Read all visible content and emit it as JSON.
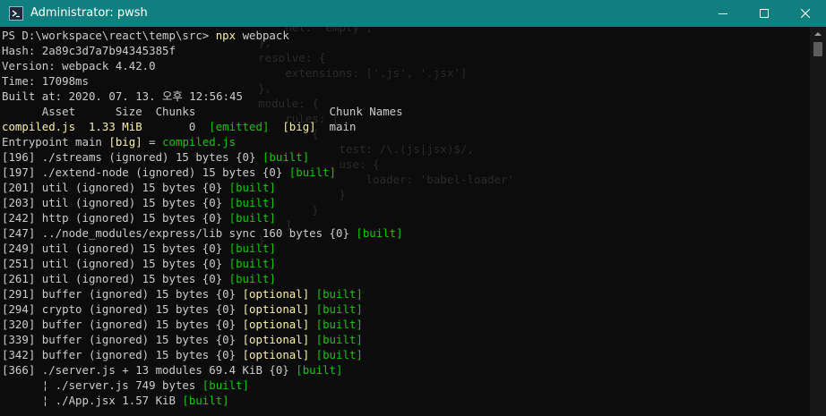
{
  "window": {
    "title": "Administrator: pwsh",
    "colors": {
      "titlebar": "#0f7f7f",
      "background": "#0c0c0c",
      "text": "#cccccc",
      "yellow": "#f9f1a5",
      "green": "#16c60c"
    }
  },
  "ghost_lines": [
    {
      "text": "        net: 'empty',",
      "row": 0
    },
    {
      "text": "    },",
      "row": 1
    },
    {
      "text": "    resolve: {",
      "row": 2
    },
    {
      "text": "        extensions: ['.js', '.jsx']",
      "row": 3
    },
    {
      "text": "    },",
      "row": 4
    },
    {
      "text": "    module: {",
      "row": 5
    },
    {
      "text": "        rules: [",
      "row": 6
    },
    {
      "text": "            {",
      "row": 7
    },
    {
      "text": "                test: /\\.(js|jsx)$/,",
      "row": 8
    },
    {
      "text": "                use: {",
      "row": 9
    },
    {
      "text": "                    loader: 'babel-loader'",
      "row": 10
    },
    {
      "text": "                }",
      "row": 11
    },
    {
      "text": "            }",
      "row": 12
    },
    {
      "text": "        ]",
      "row": 13
    },
    {
      "text": "    }",
      "row": 14
    }
  ],
  "lines": [
    [
      {
        "t": "PS D:\\workspace\\react\\temp\\src> ",
        "c": "default"
      },
      {
        "t": "npx",
        "c": "yellow"
      },
      {
        "t": " webpack",
        "c": "default"
      }
    ],
    [
      {
        "t": "Hash: 2a89c3d7a7b94345385f",
        "c": "default"
      }
    ],
    [
      {
        "t": "Version: webpack 4.42.0",
        "c": "default"
      }
    ],
    [
      {
        "t": "Time: 17098ms",
        "c": "default"
      }
    ],
    [
      {
        "t": "Built at: 2020. 07. 13. 오후 12:56:45",
        "c": "default"
      }
    ],
    [
      {
        "t": "      Asset      Size  Chunks                    Chunk Names",
        "c": "default"
      }
    ],
    [
      {
        "t": "compiled.js  1.33 MiB",
        "c": "yellow"
      },
      {
        "t": "       0  ",
        "c": "default"
      },
      {
        "t": "[emitted]",
        "c": "green"
      },
      {
        "t": "  ",
        "c": "default"
      },
      {
        "t": "[big]",
        "c": "yellow"
      },
      {
        "t": "  main",
        "c": "default"
      }
    ],
    [
      {
        "t": "Entrypoint main ",
        "c": "default"
      },
      {
        "t": "[big]",
        "c": "yellow"
      },
      {
        "t": " = ",
        "c": "default"
      },
      {
        "t": "compiled.js",
        "c": "green"
      }
    ],
    [
      {
        "t": "[196] ./streams (ignored) 15 bytes {0} ",
        "c": "default"
      },
      {
        "t": "[built]",
        "c": "green"
      }
    ],
    [
      {
        "t": "[197] ./extend-node (ignored) 15 bytes {0} ",
        "c": "default"
      },
      {
        "t": "[built]",
        "c": "green"
      }
    ],
    [
      {
        "t": "[201] util (ignored) 15 bytes {0} ",
        "c": "default"
      },
      {
        "t": "[built]",
        "c": "green"
      }
    ],
    [
      {
        "t": "[203] util (ignored) 15 bytes {0} ",
        "c": "default"
      },
      {
        "t": "[built]",
        "c": "green"
      }
    ],
    [
      {
        "t": "[242] http (ignored) 15 bytes {0} ",
        "c": "default"
      },
      {
        "t": "[built]",
        "c": "green"
      }
    ],
    [
      {
        "t": "[247] ../node_modules/express/lib sync 160 bytes {0} ",
        "c": "default"
      },
      {
        "t": "[built]",
        "c": "green"
      }
    ],
    [
      {
        "t": "[249] util (ignored) 15 bytes {0} ",
        "c": "default"
      },
      {
        "t": "[built]",
        "c": "green"
      }
    ],
    [
      {
        "t": "[251] util (ignored) 15 bytes {0} ",
        "c": "default"
      },
      {
        "t": "[built]",
        "c": "green"
      }
    ],
    [
      {
        "t": "[261] util (ignored) 15 bytes {0} ",
        "c": "default"
      },
      {
        "t": "[built]",
        "c": "green"
      }
    ],
    [
      {
        "t": "[291] buffer (ignored) 15 bytes {0} ",
        "c": "default"
      },
      {
        "t": "[optional]",
        "c": "yellow"
      },
      {
        "t": " ",
        "c": "default"
      },
      {
        "t": "[built]",
        "c": "green"
      }
    ],
    [
      {
        "t": "[294] crypto (ignored) 15 bytes {0} ",
        "c": "default"
      },
      {
        "t": "[optional]",
        "c": "yellow"
      },
      {
        "t": " ",
        "c": "default"
      },
      {
        "t": "[built]",
        "c": "green"
      }
    ],
    [
      {
        "t": "[320] buffer (ignored) 15 bytes {0} ",
        "c": "default"
      },
      {
        "t": "[optional]",
        "c": "yellow"
      },
      {
        "t": " ",
        "c": "default"
      },
      {
        "t": "[built]",
        "c": "green"
      }
    ],
    [
      {
        "t": "[339] buffer (ignored) 15 bytes {0} ",
        "c": "default"
      },
      {
        "t": "[optional]",
        "c": "yellow"
      },
      {
        "t": " ",
        "c": "default"
      },
      {
        "t": "[built]",
        "c": "green"
      }
    ],
    [
      {
        "t": "[342] buffer (ignored) 15 bytes {0} ",
        "c": "default"
      },
      {
        "t": "[optional]",
        "c": "yellow"
      },
      {
        "t": " ",
        "c": "default"
      },
      {
        "t": "[built]",
        "c": "green"
      }
    ],
    [
      {
        "t": "[366] ./server.js + 13 modules 69.4 KiB {0} ",
        "c": "default"
      },
      {
        "t": "[built]",
        "c": "green"
      }
    ],
    [
      {
        "t": "      ¦ ./server.js 749 bytes ",
        "c": "default"
      },
      {
        "t": "[built]",
        "c": "green"
      }
    ],
    [
      {
        "t": "      ¦ ./App.jsx 1.57 KiB ",
        "c": "default"
      },
      {
        "t": "[built]",
        "c": "green"
      }
    ]
  ]
}
